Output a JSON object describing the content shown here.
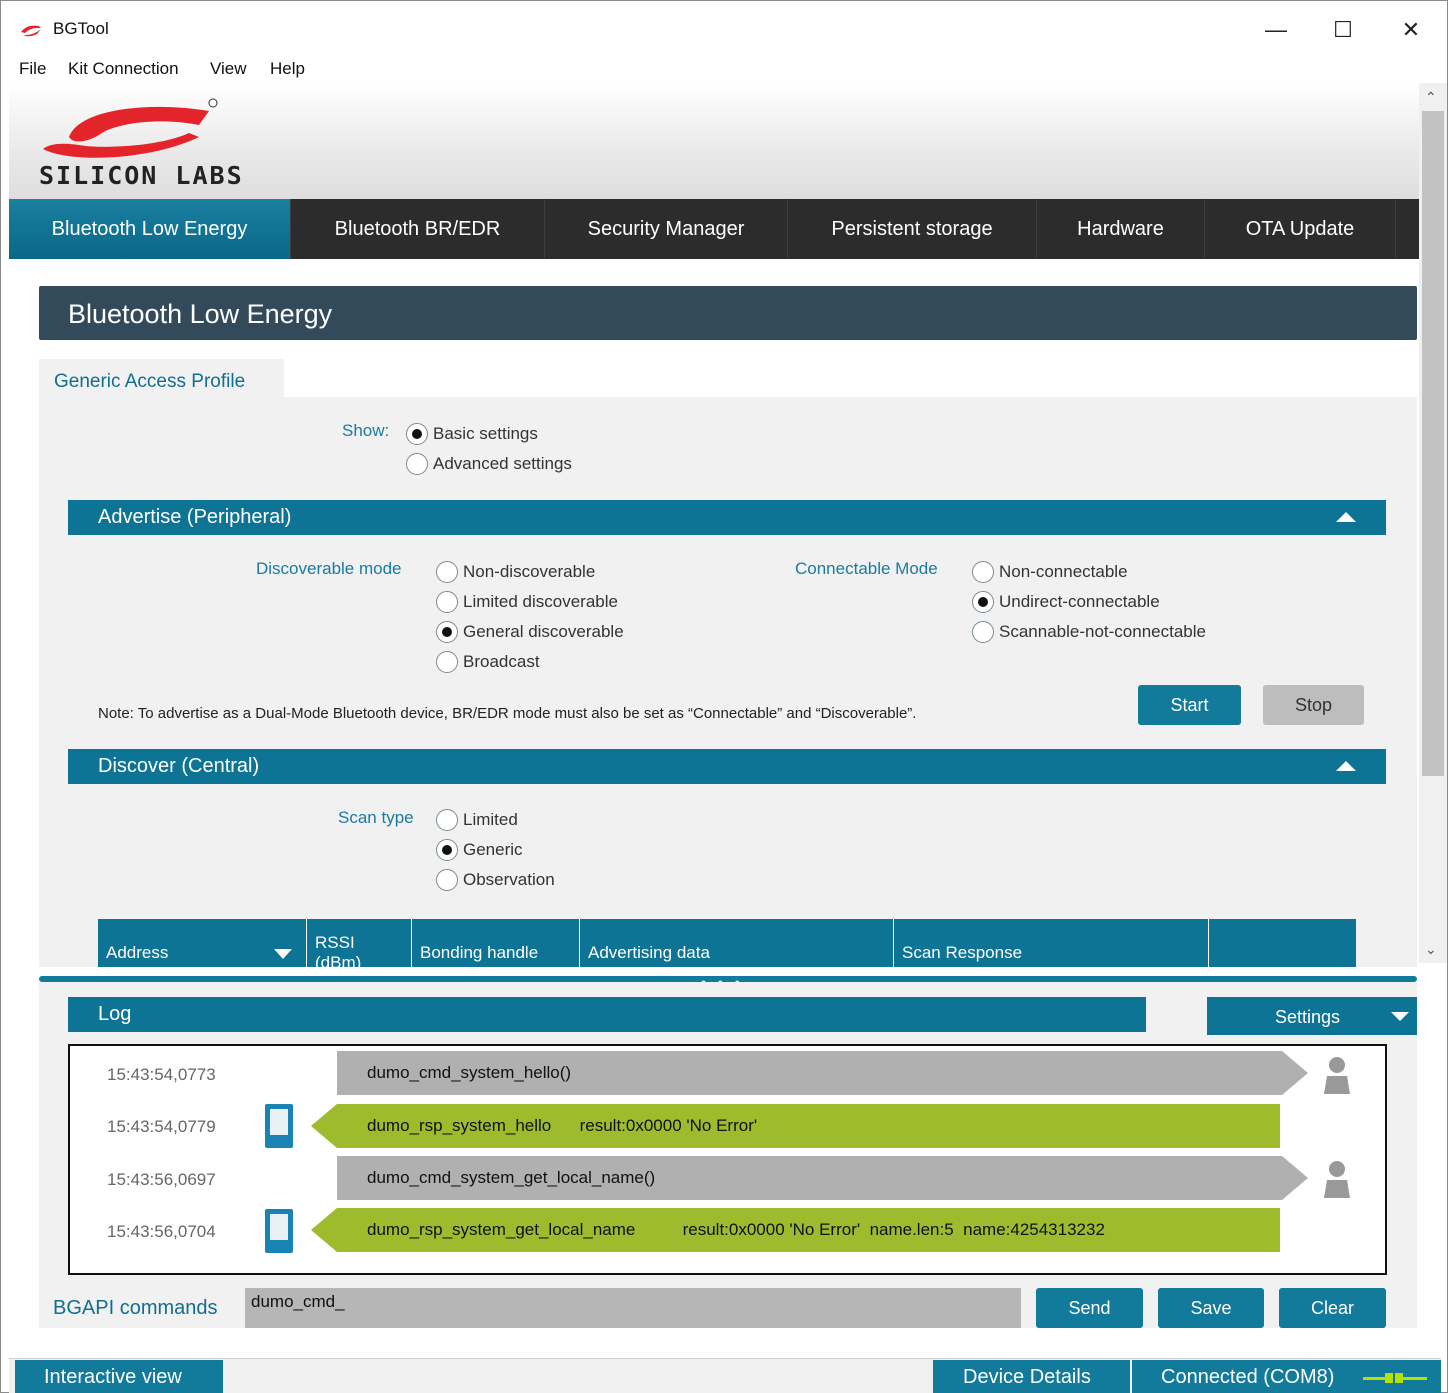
{
  "window": {
    "title": "BGTool",
    "controls": {
      "minimize": "—",
      "maximize": "☐",
      "close": "✕"
    }
  },
  "menu": [
    "File",
    "Kit Connection",
    "View",
    "Help"
  ],
  "brand": {
    "logo_text": "SILICON LABS",
    "logo_color": "#e3242b"
  },
  "tabs": [
    {
      "label": "Bluetooth Low Energy",
      "active": true
    },
    {
      "label": "Bluetooth BR/EDR",
      "active": false
    },
    {
      "label": "Security Manager",
      "active": false
    },
    {
      "label": "Persistent storage",
      "active": false
    },
    {
      "label": "Hardware",
      "active": false
    },
    {
      "label": "OTA Update",
      "active": false
    }
  ],
  "page": {
    "title": "Bluetooth Low Energy",
    "subtab": "Generic Access Profile",
    "show": {
      "label": "Show:",
      "options": [
        {
          "label": "Basic settings",
          "checked": true
        },
        {
          "label": "Advanced settings",
          "checked": false
        }
      ]
    },
    "advertise": {
      "title": "Advertise (Peripheral)",
      "discoverable": {
        "label": "Discoverable mode",
        "options": [
          {
            "label": "Non-discoverable",
            "checked": false
          },
          {
            "label": "Limited discoverable",
            "checked": false
          },
          {
            "label": "General discoverable",
            "checked": true
          },
          {
            "label": "Broadcast",
            "checked": false
          }
        ]
      },
      "connectable": {
        "label": "Connectable Mode",
        "options": [
          {
            "label": "Non-connectable",
            "checked": false
          },
          {
            "label": "Undirect-connectable",
            "checked": true
          },
          {
            "label": "Scannable-not-connectable",
            "checked": false
          }
        ]
      },
      "note": "Note: To advertise as a Dual-Mode Bluetooth device, BR/EDR mode must also be set as “Connectable” and “Discoverable”.",
      "start_label": "Start",
      "stop_label": "Stop"
    },
    "discover": {
      "title": "Discover (Central)",
      "scan_type": {
        "label": "Scan type",
        "options": [
          {
            "label": "Limited",
            "checked": false
          },
          {
            "label": "Generic",
            "checked": true
          },
          {
            "label": "Observation",
            "checked": false
          }
        ]
      },
      "columns": [
        "Address",
        "RSSI (dBm)",
        "Bonding handle",
        "Advertising data",
        "Scan Response",
        ""
      ]
    }
  },
  "log": {
    "title": "Log",
    "settings_label": "Settings",
    "entries": [
      {
        "time": "15:43:54,0773",
        "kind": "cmd",
        "text": "dumo_cmd_system_hello()"
      },
      {
        "time": "15:43:54,0779",
        "kind": "rsp",
        "text": "dumo_rsp_system_hello      result:0x0000 'No Error'"
      },
      {
        "time": "15:43:56,0697",
        "kind": "cmd",
        "text": "dumo_cmd_system_get_local_name()"
      },
      {
        "time": "15:43:56,0704",
        "kind": "rsp",
        "text": "dumo_rsp_system_get_local_name          result:0x0000 'No Error'  name.len:5  name:4254313232"
      }
    ]
  },
  "bgapi": {
    "label": "BGAPI commands",
    "value": "dumo_cmd_",
    "send_label": "Send",
    "save_label": "Save",
    "clear_label": "Clear"
  },
  "status": {
    "interactive_view": "Interactive view",
    "device_details": "Device Details",
    "connection": "Connected (COM8)"
  },
  "colors": {
    "accent": "#0e7495",
    "cmd_bubble": "#b0b0b0",
    "rsp_bubble": "#9ebb2e",
    "title_bar": "#324a5a"
  }
}
